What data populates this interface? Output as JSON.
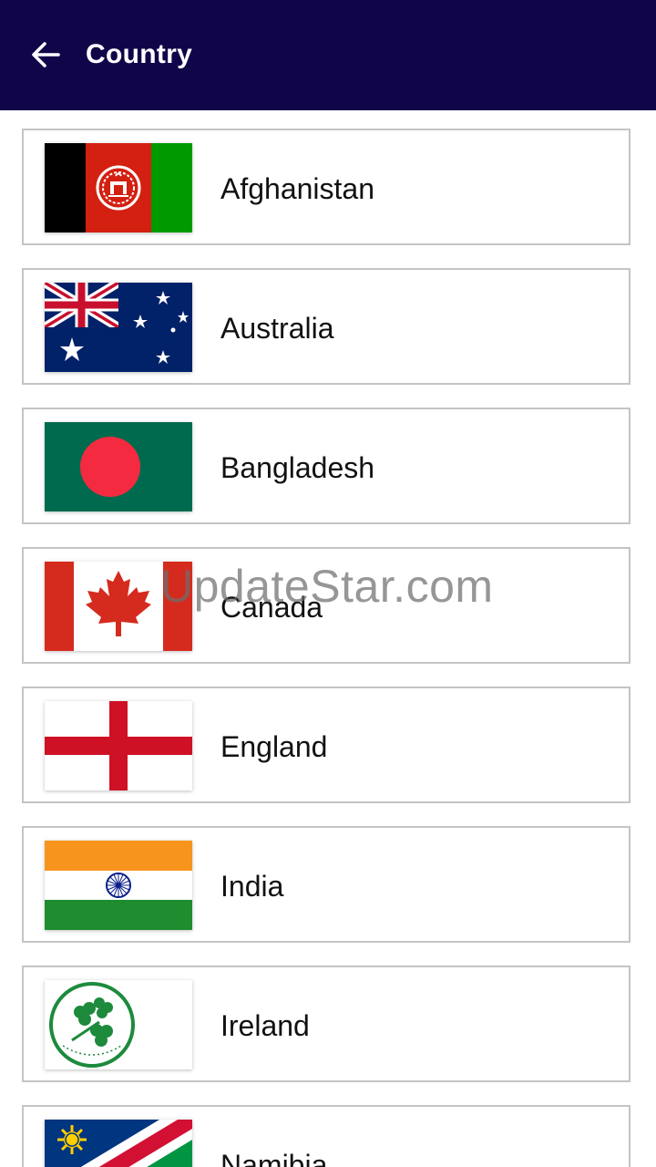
{
  "appbar": {
    "title": "Country",
    "back_icon": "arrow-left-icon",
    "background": "#11054a"
  },
  "countries": [
    {
      "name": "Afghanistan",
      "flag": "afghanistan-flag"
    },
    {
      "name": "Australia",
      "flag": "australia-flag"
    },
    {
      "name": "Bangladesh",
      "flag": "bangladesh-flag"
    },
    {
      "name": "Canada",
      "flag": "canada-flag"
    },
    {
      "name": "England",
      "flag": "england-flag"
    },
    {
      "name": "India",
      "flag": "india-flag"
    },
    {
      "name": "Ireland",
      "flag": "ireland-cricket-flag"
    },
    {
      "name": "Namibia",
      "flag": "namibia-flag"
    }
  ],
  "watermark": "UpdateStar.com"
}
